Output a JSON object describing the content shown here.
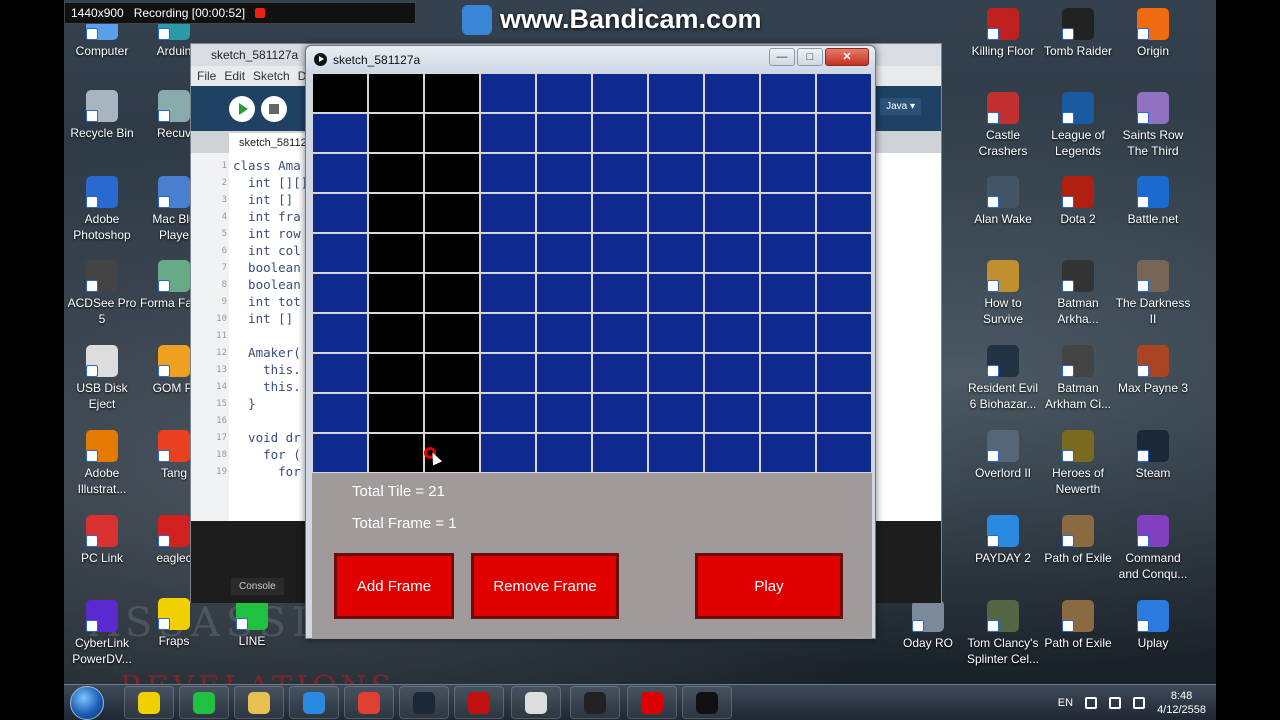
{
  "recorder": {
    "resolution": "1440x900",
    "recording_text": "Recording [00:00:52]",
    "watermark": "www.Bandicam.com"
  },
  "desktop_icons_left": [
    {
      "label": "Computer",
      "color": "#5aa0e8"
    },
    {
      "label": "Recycle Bin",
      "color": "#a8b4c0"
    },
    {
      "label": "Adobe Photoshop",
      "color": "#2a6ad0"
    },
    {
      "label": "ACDSee Pro 5",
      "color": "#444"
    },
    {
      "label": "USB Disk Eject",
      "color": "#ddd"
    },
    {
      "label": "Adobe Illustrat...",
      "color": "#e47b00"
    },
    {
      "label": "PC Link",
      "color": "#d93030"
    },
    {
      "label": "CyberLink PowerDV...",
      "color": "#5a2ad0"
    }
  ],
  "desktop_icons_left2": [
    {
      "label": "Arduin",
      "color": "#2a9ca8"
    },
    {
      "label": "Recuv",
      "color": "#8aa"
    },
    {
      "label": "Mac Blu Playe",
      "color": "#4a7fd0"
    },
    {
      "label": "Forma Facto",
      "color": "#6a8"
    },
    {
      "label": "GOM Pl",
      "color": "#f0a020"
    },
    {
      "label": "Tang",
      "color": "#e84020"
    },
    {
      "label": "eaglec",
      "color": "#d02020"
    },
    {
      "label": "Fraps",
      "color": "#f0d000"
    },
    {
      "label": "LINE",
      "color": "#20c040"
    }
  ],
  "desktop_icons_right": [
    {
      "label": "Killing Floor",
      "color": "#c02020"
    },
    {
      "label": "Tomb Raider",
      "color": "#222"
    },
    {
      "label": "Origin",
      "color": "#f06a10"
    },
    {
      "label": "Castle Crashers",
      "color": "#c03030"
    },
    {
      "label": "League of Legends",
      "color": "#1a5aa0"
    },
    {
      "label": "Saints Row The Third",
      "color": "#9070c0"
    },
    {
      "label": "Alan Wake",
      "color": "#445566"
    },
    {
      "label": "Dota 2",
      "color": "#b02010"
    },
    {
      "label": "Battle.net",
      "color": "#1a6ad0"
    },
    {
      "label": "How to Survive",
      "color": "#c09030"
    },
    {
      "label": "Batman Arkha...",
      "color": "#333"
    },
    {
      "label": "The Darkness II",
      "color": "#776655"
    },
    {
      "label": "Resident Evil 6 Biohazar...",
      "color": "#223344"
    },
    {
      "label": "Batman Arkham Ci...",
      "color": "#444"
    },
    {
      "label": "Max Payne 3",
      "color": "#aa4422"
    },
    {
      "label": "Overlord II",
      "color": "#556677"
    },
    {
      "label": "Heroes of Newerth",
      "color": "#7a6a20"
    },
    {
      "label": "Steam",
      "color": "#1b2838"
    },
    {
      "label": "PAYDAY 2",
      "color": "#2a8ae0"
    },
    {
      "label": "Path of Exile",
      "color": "#8a6a40"
    },
    {
      "label": "Command and Conqu...",
      "color": "#8040c0"
    },
    {
      "label": "Oday RO",
      "color": "#7a8a9a"
    },
    {
      "label": "Tom Clancy's Splinter Cel...",
      "color": "#556644"
    },
    {
      "label": "Path of Exile",
      "color": "#8a6a40"
    },
    {
      "label": "Uplay",
      "color": "#2a7ae0"
    }
  ],
  "ide": {
    "title": "sketch_581127a",
    "menu": [
      "File",
      "Edit",
      "Sketch",
      "De"
    ],
    "tab": "sketch_58112",
    "mode": "Java ▾",
    "console": "Console",
    "code": [
      {
        "n": "1",
        "t": "class Ama"
      },
      {
        "n": "2",
        "t": "  int [][]"
      },
      {
        "n": "3",
        "t": "  int []"
      },
      {
        "n": "4",
        "t": "  int fra"
      },
      {
        "n": "5",
        "t": "  int row"
      },
      {
        "n": "6",
        "t": "  int col"
      },
      {
        "n": "7",
        "t": "  boolean"
      },
      {
        "n": "8",
        "t": "  boolean"
      },
      {
        "n": "9",
        "t": "  int tot"
      },
      {
        "n": "10",
        "t": "  int []"
      },
      {
        "n": "11",
        "t": ""
      },
      {
        "n": "12",
        "t": "  Amaker("
      },
      {
        "n": "13",
        "t": "    this."
      },
      {
        "n": "14",
        "t": "    this."
      },
      {
        "n": "15",
        "t": "  }"
      },
      {
        "n": "16",
        "t": ""
      },
      {
        "n": "17",
        "t": "  void dr"
      },
      {
        "n": "18",
        "t": "    for ("
      },
      {
        "n": "19",
        "t": "      for"
      }
    ]
  },
  "sketch": {
    "title": "sketch_581127a",
    "controls": {
      "minimize": "—",
      "maximize": "□",
      "close": "✕"
    },
    "grid": {
      "rows": 10,
      "cols": 10,
      "on_color": "#000000",
      "off_color": "#0f2b8f",
      "cells": [
        [
          1,
          1,
          1,
          0,
          0,
          0,
          0,
          0,
          0,
          0
        ],
        [
          0,
          1,
          1,
          0,
          0,
          0,
          0,
          0,
          0,
          0
        ],
        [
          0,
          1,
          1,
          0,
          0,
          0,
          0,
          0,
          0,
          0
        ],
        [
          0,
          1,
          1,
          0,
          0,
          0,
          0,
          0,
          0,
          0
        ],
        [
          0,
          1,
          1,
          0,
          0,
          0,
          0,
          0,
          0,
          0
        ],
        [
          0,
          1,
          1,
          0,
          0,
          0,
          0,
          0,
          0,
          0
        ],
        [
          0,
          1,
          1,
          0,
          0,
          0,
          0,
          0,
          0,
          0
        ],
        [
          0,
          1,
          1,
          0,
          0,
          0,
          0,
          0,
          0,
          0
        ],
        [
          0,
          1,
          1,
          0,
          0,
          0,
          0,
          0,
          0,
          0
        ],
        [
          0,
          1,
          1,
          0,
          0,
          0,
          0,
          0,
          0,
          0
        ]
      ]
    },
    "total_tile": "Total Tile = 21",
    "total_frame": "Total Frame = 1",
    "buttons": {
      "add_frame": "Add Frame",
      "remove_frame": "Remove Frame",
      "play": "Play"
    }
  },
  "taskbar": {
    "apps": [
      {
        "name": "fraps",
        "label": "99",
        "color": "#f0d000"
      },
      {
        "name": "line",
        "label": "LINE",
        "color": "#20c040"
      },
      {
        "name": "explorer",
        "label": "",
        "color": "#e8c050"
      },
      {
        "name": "ie",
        "label": "e",
        "color": "#2a8ae0"
      },
      {
        "name": "chrome",
        "label": "",
        "color": "#e04030"
      },
      {
        "name": "steam",
        "label": "",
        "color": "#1b2838"
      },
      {
        "name": "ninja",
        "label": "",
        "color": "#c01010"
      },
      {
        "name": "photoscape",
        "label": "",
        "color": "#ddd"
      },
      {
        "name": "processing",
        "label": "P3",
        "color": "#222"
      },
      {
        "name": "bandicam",
        "label": "",
        "color": "#d00"
      },
      {
        "name": "sketch",
        "label": "",
        "color": "#111"
      }
    ],
    "lang": "EN",
    "time": "8:48",
    "date": "4/12/2558"
  }
}
